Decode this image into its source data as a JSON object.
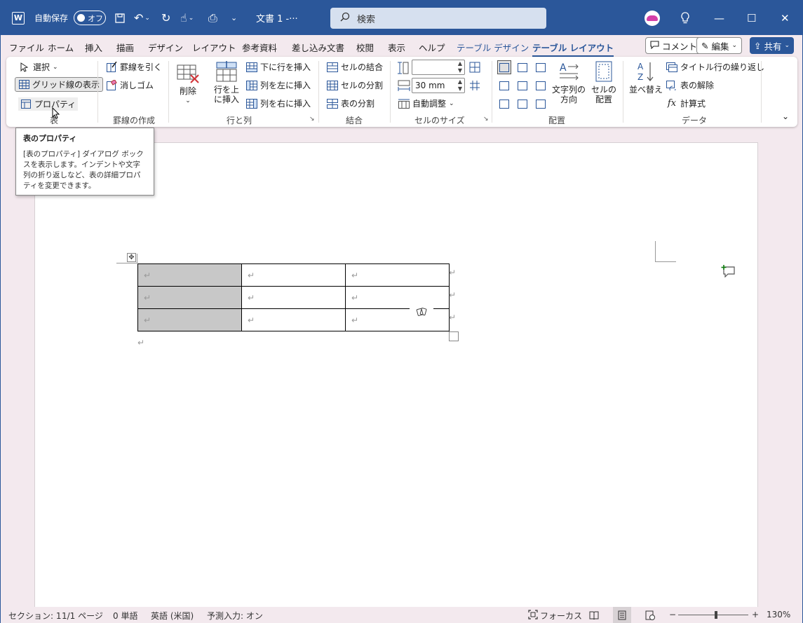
{
  "titlebar": {
    "app_logo": "W",
    "autosave_label": "自動保存",
    "autosave_state": "オフ",
    "qat_icons": [
      "save-icon",
      "undo-icon",
      "redo-icon",
      "touch-mode-icon",
      "print-preview-icon",
      "customize-qat-icon"
    ],
    "doc_title": "文書 1  -···",
    "search_placeholder": "検索",
    "lightbulb": "💡",
    "minimize": "—",
    "maximize": "☐",
    "close": "✕"
  },
  "tabs": {
    "items": [
      "ファイル",
      "ホーム",
      "挿入",
      "描画",
      "デザイン",
      "レイアウト",
      "参考資料",
      "差し込み文書",
      "校閲",
      "表示",
      "ヘルプ"
    ],
    "context_tabs": [
      "テーブル デザイン",
      "テーブル レイアウト"
    ],
    "comment_btn": "コメント",
    "edit_btn": "編集",
    "share_btn": "共有"
  },
  "ribbon": {
    "table_group": {
      "select": "選択",
      "gridlines": "グリッド線の表示",
      "properties": "プロパティ",
      "label": "表"
    },
    "draw_group": {
      "draw_borders": "罫線を引く",
      "eraser": "消しゴム",
      "label": "罫線の作成"
    },
    "delete_btn": "削除",
    "rows_cols": {
      "insert_above_line1": "行を上",
      "insert_above_line2": "に挿入",
      "insert_below": "下に行を挿入",
      "insert_left": "列を左に挿入",
      "insert_right": "列を右に挿入",
      "label": "行と列"
    },
    "merge": {
      "merge_cells": "セルの結合",
      "split_cells": "セルの分割",
      "split_table": "表の分割",
      "label": "結合"
    },
    "cell_size": {
      "height_value": "",
      "width_value": "30 mm",
      "autofit": "自動調整",
      "label": "セルのサイズ"
    },
    "alignment": {
      "text_direction_line1": "文字列の",
      "text_direction_line2": "方向",
      "cell_margins_line1": "セルの",
      "cell_margins_line2": "配置",
      "label": "配置"
    },
    "data": {
      "sort": "並べ替え",
      "repeat_header": "タイトル行の繰り返し",
      "convert_to_text": "表の解除",
      "formula": "計算式",
      "label": "データ"
    }
  },
  "tooltip": {
    "title": "表のプロパティ",
    "body": "[表のプロパティ] ダイアログ ボックスを表示します。インデントや文字列の折り返しなど、表の詳細プロパティを変更できます。"
  },
  "document": {
    "paragraph_mark": "↵",
    "table_rows": [
      [
        "↵",
        "↵",
        "↵"
      ],
      [
        "↵",
        "↵",
        "↵"
      ],
      [
        "↵",
        "↵",
        "↵"
      ]
    ],
    "row_end_mark": "↵"
  },
  "status": {
    "section": "セクション: 1",
    "page": "1/1 ページ",
    "words": "0 単語",
    "language": "英語 (米国)",
    "predictive": "予測入力: オン",
    "focus": "フォーカス",
    "zoom": "130%",
    "zoom_minus": "−",
    "zoom_plus": "+"
  }
}
